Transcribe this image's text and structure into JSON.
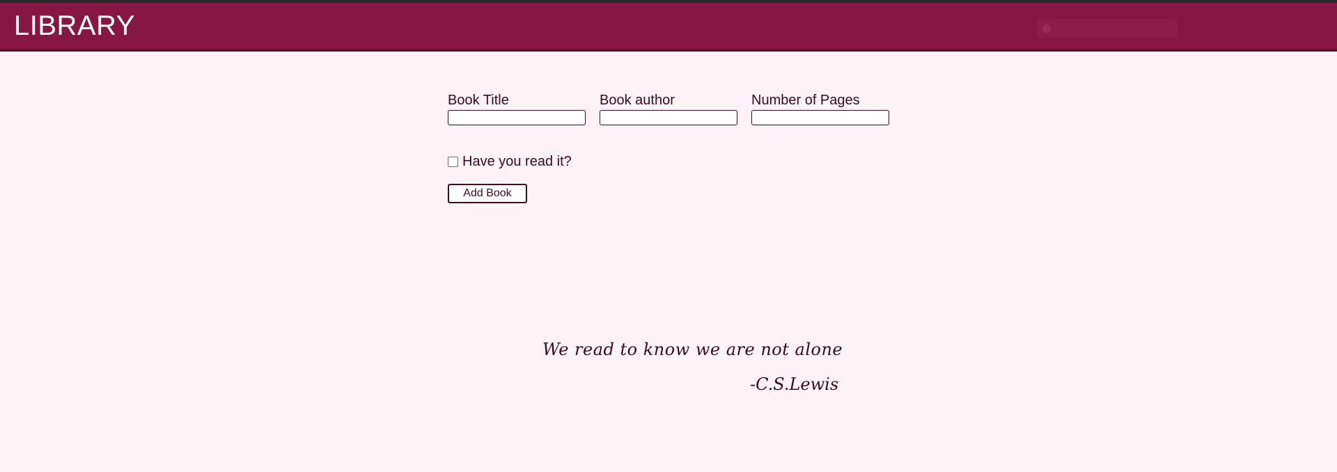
{
  "header": {
    "title": "LIBRARY"
  },
  "form": {
    "title_label": "Book Title",
    "author_label": "Book author",
    "pages_label": "Number of Pages",
    "title_value": "",
    "author_value": "",
    "pages_value": "",
    "read_checkbox_label": "Have you read it?",
    "read_checked": false,
    "submit_label": "Add Book"
  },
  "quote": {
    "text": "We read to know we are not alone",
    "author": "-C.S.Lewis"
  },
  "colors": {
    "header_bg": "#851742",
    "page_bg": "#fdf2f6",
    "text": "#3a0a20"
  }
}
